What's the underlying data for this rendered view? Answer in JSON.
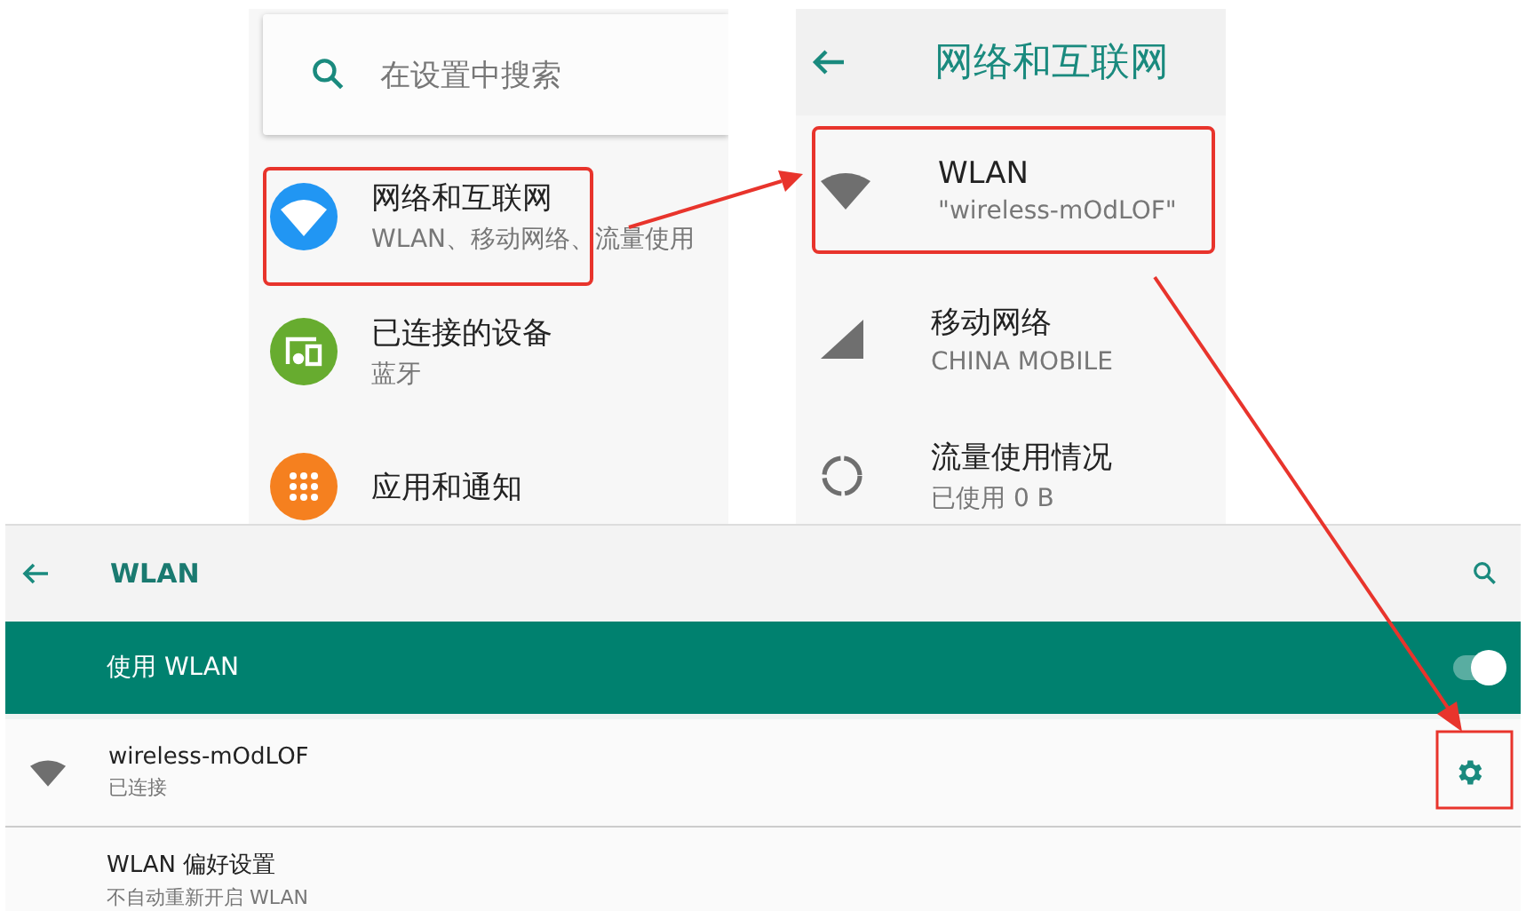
{
  "settings_panel": {
    "search": {
      "placeholder": "在设置中搜索"
    },
    "items": [
      {
        "kind": "wifi",
        "title": "网络和互联网",
        "subtitle": "WLAN、移动网络、流量使用",
        "color": "#2196f3"
      },
      {
        "kind": "devices",
        "title": "已连接的设备",
        "subtitle": "蓝牙",
        "color": "#67ac2f"
      },
      {
        "kind": "apps",
        "title": "应用和通知",
        "color": "#f5801f"
      }
    ]
  },
  "network_panel": {
    "title": "网络和互联网",
    "items": [
      {
        "kind": "wifi",
        "title": "WLAN",
        "subtitle": "\"wireless-mOdLOF\""
      },
      {
        "kind": "signal",
        "title": "移动网络",
        "subtitle": "CHINA MOBILE"
      },
      {
        "kind": "data",
        "title": "流量使用情况",
        "subtitle": "已使用 0 B"
      }
    ]
  },
  "wlan_panel": {
    "title": "WLAN",
    "master": {
      "label": "使用 WLAN",
      "on": true
    },
    "networks": [
      {
        "name": "wireless-mOdLOF",
        "status": "已连接"
      }
    ],
    "preferences": {
      "title": "WLAN 偏好设置",
      "subtitle": "不自动重新开启 WLAN"
    }
  }
}
